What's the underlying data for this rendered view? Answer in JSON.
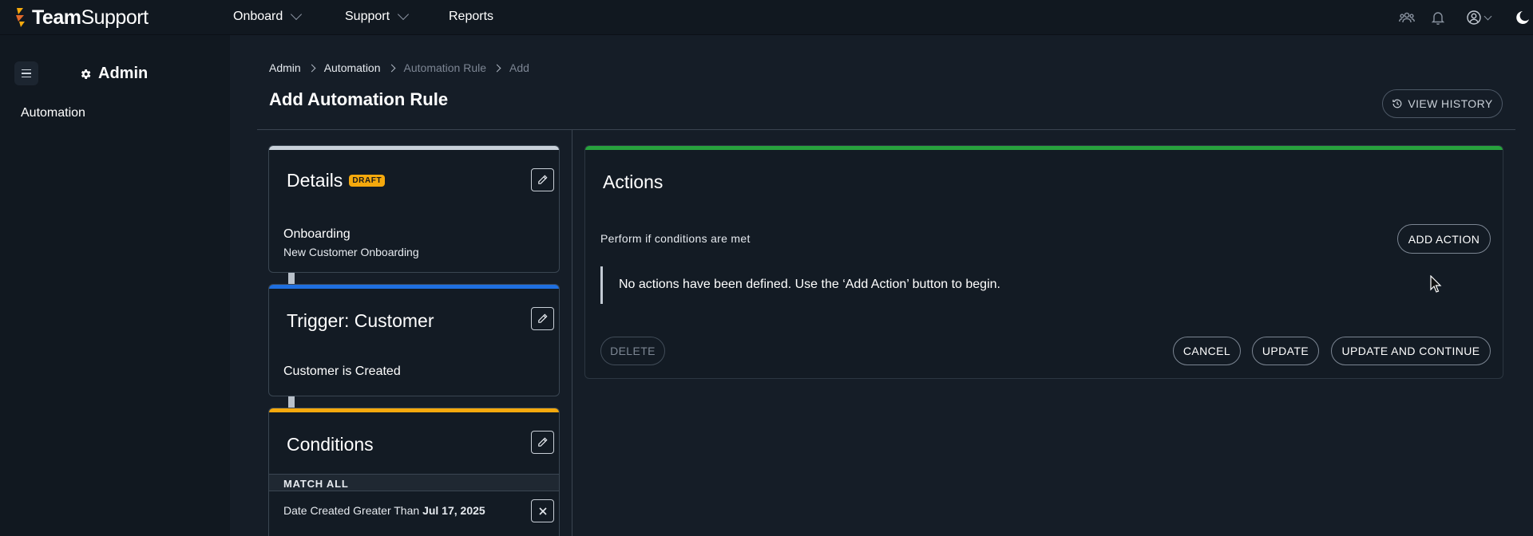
{
  "app": {
    "logo_text_bold": "Team",
    "logo_text_rest": "Support"
  },
  "topnav": {
    "items": [
      {
        "label": "Onboard",
        "has_dropdown": true
      },
      {
        "label": "Support",
        "has_dropdown": true
      },
      {
        "label": "Reports",
        "has_dropdown": false
      }
    ],
    "icons": [
      "team-icon",
      "bell-icon",
      "user-account-icon",
      "dark-mode-moon-icon"
    ]
  },
  "sidebar": {
    "title": "Admin",
    "title_icon": "gear-icon",
    "items": [
      {
        "label": "Automation"
      }
    ]
  },
  "breadcrumb": {
    "items": [
      "Admin",
      "Automation",
      "Automation Rule",
      "Add"
    ]
  },
  "page": {
    "title": "Add Automation Rule",
    "view_history_label": "VIEW HISTORY"
  },
  "details_card": {
    "title": "Details",
    "badge": "DRAFT",
    "primary": "Onboarding",
    "secondary": "New Customer Onboarding",
    "accent": "#c9d1da"
  },
  "trigger_card": {
    "title": "Trigger: Customer",
    "body": "Customer is Created",
    "accent": "#1f6fe0"
  },
  "conditions_card": {
    "title": "Conditions",
    "match_label": "MATCH ALL",
    "condition_prefix": "Date Created Greater Than",
    "condition_value": "Jul 17, 2025",
    "accent": "#f5a90d"
  },
  "actions_panel": {
    "title": "Actions",
    "perform_label": "Perform if conditions are met",
    "add_action_label": "ADD ACTION",
    "empty_message": "No actions have been defined. Use the ‘Add Action’ button to begin.",
    "delete_label": "DELETE",
    "cancel_label": "CANCEL",
    "update_label": "UPDATE",
    "update_continue_label": "UPDATE AND CONTINUE",
    "accent": "#27a23d"
  }
}
